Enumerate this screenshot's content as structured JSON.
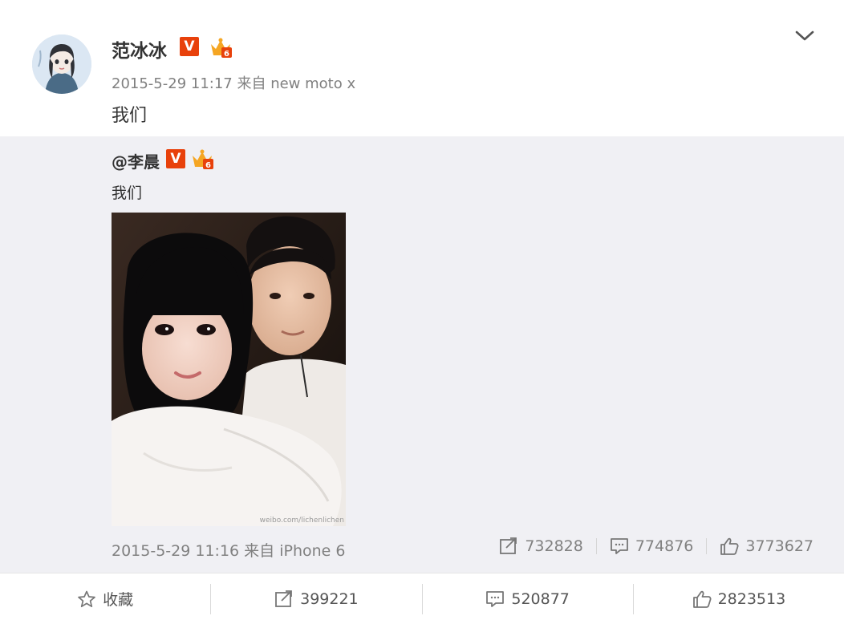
{
  "post": {
    "author": "范冰冰",
    "meta": "2015-5-29 11:17 来自 new moto x",
    "text": "我们"
  },
  "repost": {
    "author": "@李晨",
    "text": "我们",
    "watermark": "weibo.com/lichenlichen",
    "meta": "2015-5-29 11:16 来自 iPhone 6",
    "stats": {
      "reposts": "732828",
      "comments": "774876",
      "likes": "3773627"
    }
  },
  "actions": {
    "favorite": "收藏",
    "reposts": "399221",
    "comments": "520877",
    "likes": "2823513"
  },
  "colors": {
    "verified_badge": "#e8410b",
    "repost_background": "#f0f0f4",
    "meta_text": "#808080"
  },
  "icons": [
    "chevron-down-icon",
    "verified-v-icon",
    "crown-level-icon",
    "repost-icon",
    "comment-icon",
    "like-icon",
    "star-icon"
  ]
}
